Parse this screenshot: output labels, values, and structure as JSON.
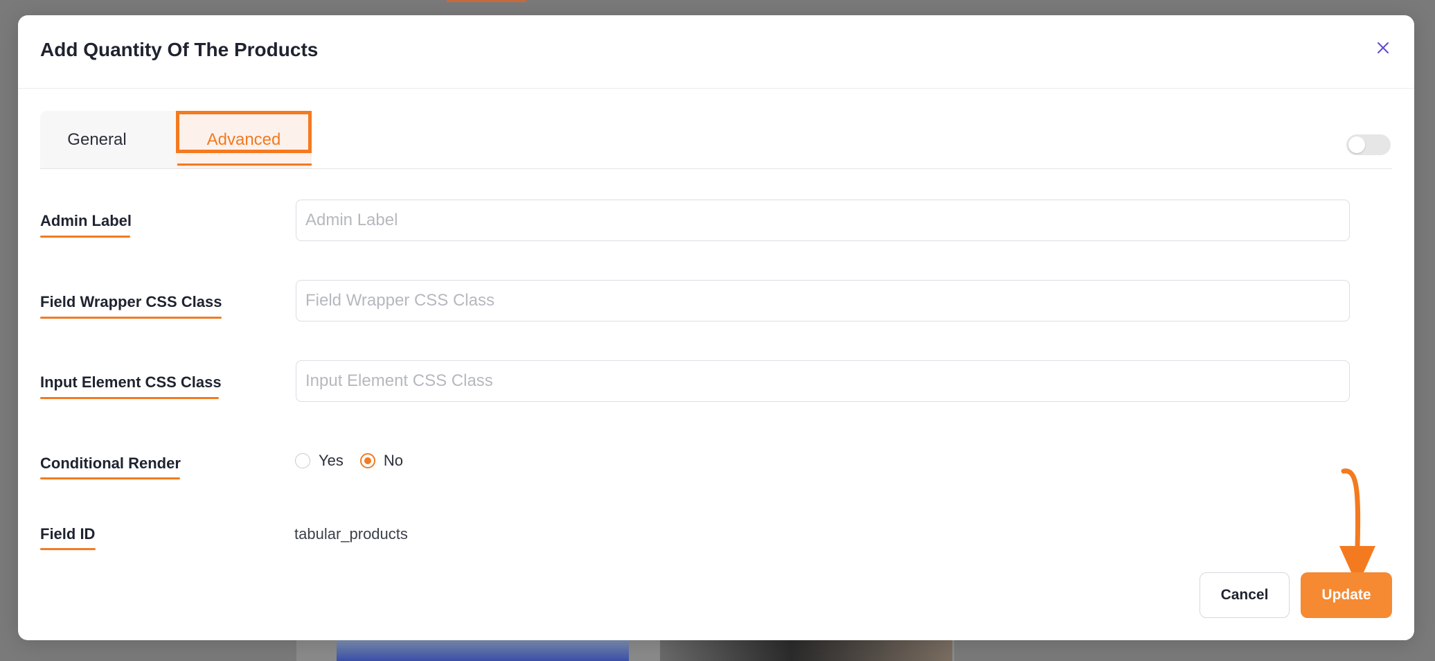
{
  "modal": {
    "title": "Add Quantity Of The Products",
    "close_icon": "close-icon"
  },
  "tabs": [
    {
      "label": "General",
      "active": false
    },
    {
      "label": "Advanced",
      "active": true
    }
  ],
  "toggle": {
    "on": false
  },
  "fields": {
    "admin_label": {
      "label": "Admin Label",
      "placeholder": "Admin Label",
      "value": ""
    },
    "wrapper_class": {
      "label": "Field Wrapper CSS Class",
      "placeholder": "Field Wrapper CSS Class",
      "value": ""
    },
    "input_class": {
      "label": "Input Element CSS Class",
      "placeholder": "Input Element CSS Class",
      "value": ""
    },
    "conditional_render": {
      "label": "Conditional Render",
      "options": [
        {
          "label": "Yes",
          "checked": false
        },
        {
          "label": "No",
          "checked": true
        }
      ]
    },
    "field_id": {
      "label": "Field ID",
      "value": "tabular_products"
    }
  },
  "buttons": {
    "cancel": "Cancel",
    "update": "Update"
  },
  "colors": {
    "accent": "#f07b22",
    "update_button": "#f58a33",
    "overlay": "#7a7a7a"
  }
}
